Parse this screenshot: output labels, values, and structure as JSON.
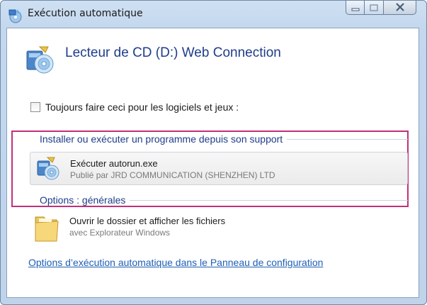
{
  "window": {
    "title": "Exécution automatique",
    "icon": "autoplay-icon",
    "controls": {
      "minimize": "minimize-icon",
      "maximize": "maximize-icon",
      "close": "close-icon"
    }
  },
  "header": {
    "title": "Lecteur de CD (D:) Web Connection",
    "icon": "cd-drive-icon"
  },
  "always_do": {
    "label": "Toujours faire ceci pour les logiciels et jeux :",
    "checked": false
  },
  "install_section": {
    "heading": "Installer ou exécuter un programme depuis son support",
    "item": {
      "title": "Exécuter autorun.exe",
      "subtitle": "Publié par JRD COMMUNICATION (SHENZHEN) LTD",
      "icon": "setup-program-icon"
    }
  },
  "general_section": {
    "heading": "Options : générales",
    "item": {
      "title": "Ouvrir le dossier et afficher les fichiers",
      "subtitle": "avec Explorateur Windows",
      "icon": "folder-icon"
    }
  },
  "control_panel_link": "Options d’exécution automatique dans le Panneau de configuration",
  "colors": {
    "heading_blue": "#1e3d8a",
    "link_blue": "#1e5fb5",
    "highlight": "#c2307a"
  }
}
